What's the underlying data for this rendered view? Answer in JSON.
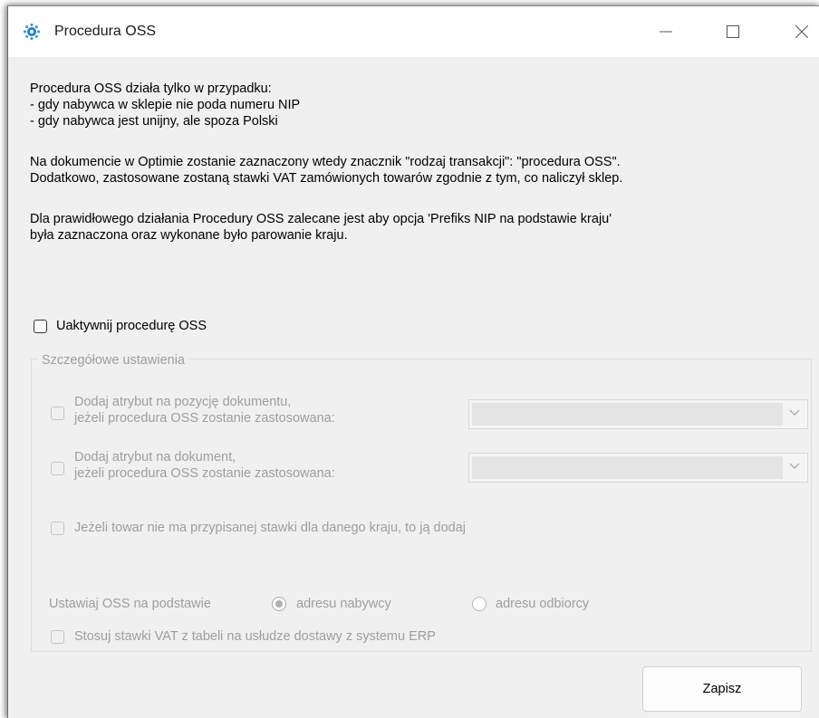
{
  "window": {
    "title": "Procedura OSS"
  },
  "intro": {
    "line1": "Procedura OSS działa tylko w przypadku:\n- gdy nabywca w sklepie nie poda numeru NIP\n- gdy nabywca jest unijny, ale spoza Polski",
    "line2": "Na dokumencie w Optimie zostanie zaznaczony wtedy znacznik \"rodzaj transakcji\": \"procedura OSS\".\nDodatkowo, zastosowane zostaną stawki VAT zamówionych towarów zgodnie z tym, co naliczył sklep.",
    "line3": "Dla prawidłowego działania Procedury OSS zalecane jest aby opcja 'Prefiks NIP na podstawie kraju'\nbyła zaznaczona oraz wykonane było parowanie kraju."
  },
  "activate": {
    "label": "Uaktywnij procedurę OSS",
    "checked": false
  },
  "details": {
    "title": "Szczegółowe ustawienia",
    "position_attr_label": "Dodaj atrybut na pozycję dokumentu,\njeżeli procedura OSS zostanie zastosowana:",
    "position_attr_value": "",
    "document_attr_label": "Dodaj atrybut na dokument,\njeżeli procedura OSS zostanie zastosowana:",
    "document_attr_value": "",
    "add_rate_label": "Jeżeli towar nie ma przypisanej stawki dla danego kraju, to ją dodaj",
    "oss_basis_label": "Ustawiaj OSS na podstawie",
    "radio_buyer_label": "adresu nabywcy",
    "radio_recipient_label": "adresu odbiorcy",
    "selected_basis": "adresu nabywcy",
    "vat_table_label": "Stosuj stawki VAT z tabeli na usłudze dostawy z systemu ERP"
  },
  "buttons": {
    "save": "Zapisz"
  },
  "icons": {
    "app": "gear-app-icon",
    "minimize": "minimize-icon",
    "maximize": "maximize-icon",
    "close": "close-icon",
    "dropdown": "chevron-down-icon"
  },
  "colors": {
    "app_icon": "#3aa0d8",
    "disabled_text": "#9e9e9e"
  }
}
